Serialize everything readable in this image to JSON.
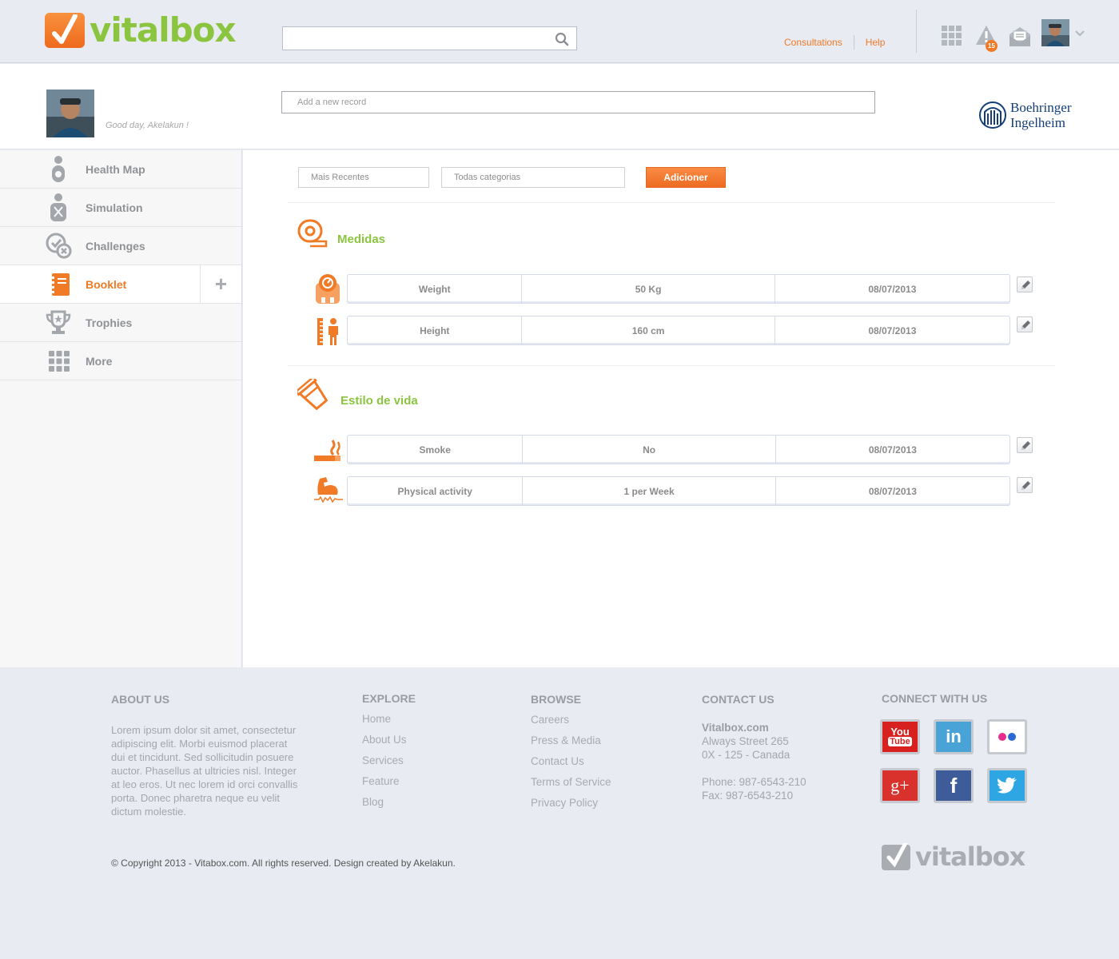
{
  "brand": {
    "name": "vitalbox",
    "accent": "#f07a26",
    "green": "#8bc53f"
  },
  "header": {
    "search_placeholder": "",
    "links": [
      "Consultations",
      "Help"
    ],
    "notification_count": "15"
  },
  "profile": {
    "greeting": "Good day, Akelakun !",
    "record_placeholder": "Add a new record",
    "partner_line1": "Boehringer",
    "partner_line2": "Ingelheim"
  },
  "sidebar": {
    "items": [
      {
        "label": "Health Map",
        "icon": "person-map-icon"
      },
      {
        "label": "Simulation",
        "icon": "simulation-icon"
      },
      {
        "label": "Challenges",
        "icon": "challenges-icon"
      },
      {
        "label": "Booklet",
        "icon": "booklet-icon",
        "active": true
      },
      {
        "label": "Trophies",
        "icon": "trophy-icon"
      },
      {
        "label": "More",
        "icon": "grid-icon"
      }
    ],
    "plus": "+"
  },
  "filters": {
    "sort": "Mais Recentes",
    "category": "Todas categorias",
    "add_button": "Adicioner"
  },
  "sections": [
    {
      "title": "Medidas",
      "rows": [
        {
          "name": "Weight",
          "value": "50 Kg",
          "date": "08/07/2013"
        },
        {
          "name": "Height",
          "value": "160 cm",
          "date": "08/07/2013"
        }
      ]
    },
    {
      "title": "Estilo de vida",
      "rows": [
        {
          "name": "Smoke",
          "value": "No",
          "date": "08/07/2013"
        },
        {
          "name": "Physical activity",
          "value": "1 per Week",
          "date": "08/07/2013"
        }
      ]
    }
  ],
  "footer": {
    "about": {
      "heading": "ABOUT US",
      "text": "Lorem ipsum dolor sit amet, consectetur adipiscing elit. Morbi euismod placerat dui et tincidunt. Sed sollicitudin posuere auctor. Phasellus at ultricies nisl. Integer at leo eros. Ut nec lorem id orci convallis porta. Donec pharetra neque eu velit dictum molestie."
    },
    "explore": {
      "heading": "EXPLORE",
      "links": [
        "Home",
        "About Us",
        "Services",
        "Feature",
        "Blog"
      ]
    },
    "browse": {
      "heading": "BROWSE",
      "links": [
        "Careers",
        "Press & Media",
        "Contact Us",
        "Terms of Service",
        "Privacy Policy"
      ]
    },
    "contact": {
      "heading": "CONTACT US",
      "company": "Vitalbox.com",
      "street": "Always Street 265",
      "city": "0X - 125 - Canada",
      "phone": "Phone: 987-6543-210",
      "fax": "Fax: 987-6543-210"
    },
    "connect": {
      "heading": "CONNECT WITH US",
      "youtube_line1": "You",
      "youtube_line2": "Tube",
      "linkedin": "in",
      "googleplus": "g+",
      "facebook": "f"
    },
    "copyright": "© Copyright 2013 - Vitabox.com. All rights reserved. Design created by Akelakun.",
    "logo": "vitalbox"
  }
}
